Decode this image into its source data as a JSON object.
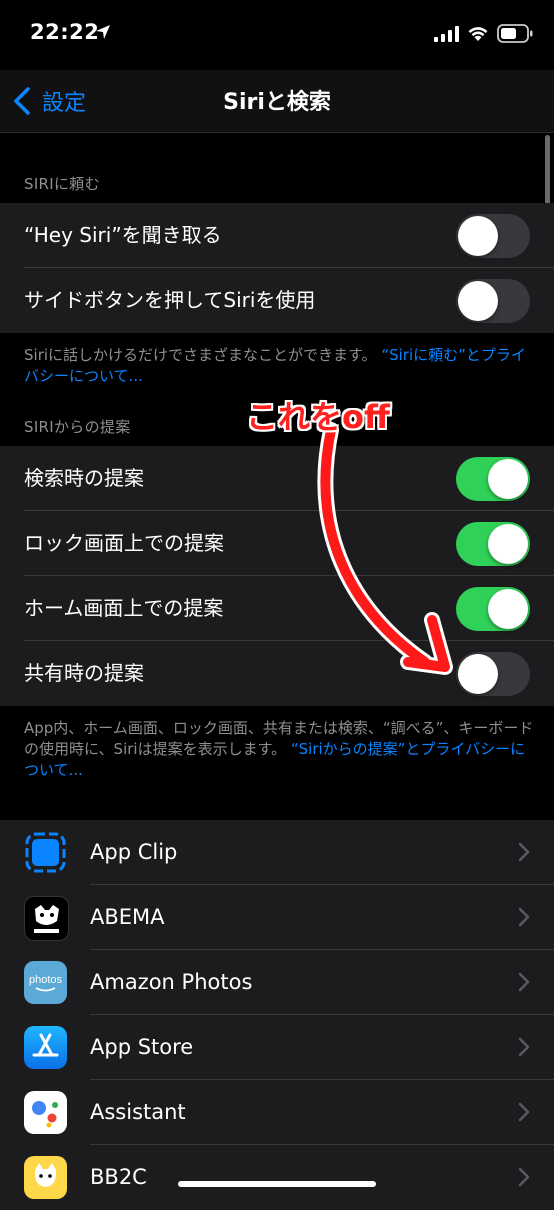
{
  "status_bar": {
    "time": "22:22"
  },
  "nav": {
    "back_label": "設定",
    "title": "Siriと検索"
  },
  "sections": {
    "ask_siri": {
      "header": "SIRIに頼む",
      "rows": [
        {
          "label": "“Hey Siri”を聞き取る",
          "on": false
        },
        {
          "label": "サイドボタンを押してSiriを使用",
          "on": false
        }
      ],
      "footnote_text": "Siriに話しかけるだけでさまざまなことができます。",
      "footnote_link": "“Siriに頼む”とプライバシーについて..."
    },
    "suggestions": {
      "header": "SIRIからの提案",
      "rows": [
        {
          "label": "検索時の提案",
          "on": true
        },
        {
          "label": "ロック画面上での提案",
          "on": true
        },
        {
          "label": "ホーム画面上での提案",
          "on": true
        },
        {
          "label": "共有時の提案",
          "on": false
        }
      ],
      "footnote_text": "App内、ホーム画面、ロック画面、共有または検索、“調べる”、キーボードの使用時に、Siriは提案を表示します。",
      "footnote_link": "“Siriからの提案”とプライバシーについて..."
    }
  },
  "apps": [
    {
      "label": "App Clip",
      "icon": "app-clip-icon"
    },
    {
      "label": "ABEMA",
      "icon": "abema-icon"
    },
    {
      "label": "Amazon Photos",
      "icon": "amazon-photos-icon",
      "icon_text": "photos"
    },
    {
      "label": "App Store",
      "icon": "app-store-icon"
    },
    {
      "label": "Assistant",
      "icon": "assistant-icon"
    },
    {
      "label": "BB2C",
      "icon": "bb2c-icon"
    }
  ],
  "annotation": {
    "text": "これをoff"
  },
  "colors": {
    "accent": "#0a84ff",
    "toggle_on": "#30d158",
    "annotation": "#ff2020"
  }
}
